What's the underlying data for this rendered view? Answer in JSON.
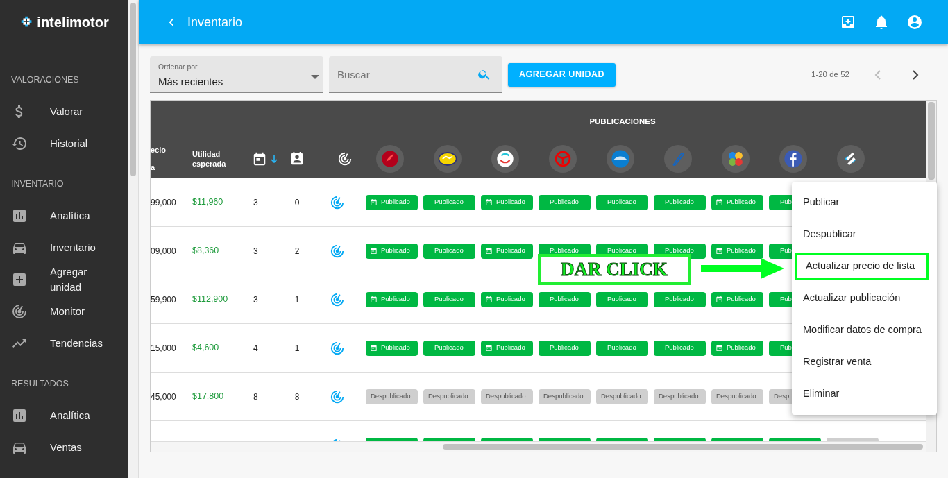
{
  "sidebar": {
    "logo": "intelimotor",
    "sections": [
      {
        "title": "VALORACIONES",
        "items": [
          {
            "label": "Valorar"
          },
          {
            "label": "Historial"
          }
        ]
      },
      {
        "title": "INVENTARIO",
        "items": [
          {
            "label": "Analítica"
          },
          {
            "label": "Inventario"
          },
          {
            "label": "Agregar unidad"
          },
          {
            "label": "Monitor"
          },
          {
            "label": "Tendencias"
          }
        ]
      },
      {
        "title": "RESULTADOS",
        "items": [
          {
            "label": "Analítica"
          },
          {
            "label": "Ventas"
          }
        ]
      }
    ]
  },
  "app_bar": {
    "title": "Inventario"
  },
  "toolbar": {
    "sort": {
      "label": "Ordenar por",
      "value": "Más recientes"
    },
    "search": {
      "placeholder": "Buscar"
    },
    "add_button": "AGREGAR UNIDAD",
    "pagination": "1-20 de 52",
    "prev": {
      "disabled": true
    },
    "next": {
      "disabled": false
    }
  },
  "table": {
    "group_header": "PUBLICACIONES",
    "columns": [
      {
        "lines": [
          "ecio",
          "a"
        ]
      },
      {
        "lines": [
          "Utilidad",
          "esperada"
        ]
      }
    ],
    "days_sorted": true,
    "rows": [
      {
        "price": "99,000",
        "profit": "$11,960",
        "days": "3",
        "leads": "0",
        "pubs": [
          {
            "published": true,
            "icon": true,
            "label": "Publicado"
          },
          {
            "published": true,
            "icon": false,
            "label": "Publicado"
          },
          {
            "published": true,
            "icon": true,
            "label": "Publicado"
          },
          {
            "published": true,
            "icon": false,
            "label": "Publicado"
          },
          {
            "published": true,
            "icon": false,
            "label": "Publicado"
          },
          {
            "published": true,
            "icon": false,
            "label": "Publicado"
          },
          {
            "published": true,
            "icon": true,
            "label": "Publicado"
          },
          {
            "published": true,
            "icon": false,
            "label": "Pub"
          }
        ]
      },
      {
        "price": "09,000",
        "profit": "$8,360",
        "days": "3",
        "leads": "2",
        "pubs": [
          {
            "published": true,
            "icon": true,
            "label": "Publicado"
          },
          {
            "published": true,
            "icon": false,
            "label": "Publicado"
          },
          {
            "published": true,
            "icon": true,
            "label": "Publicado"
          },
          {
            "published": true,
            "icon": false,
            "label": "Publicado"
          },
          {
            "published": true,
            "icon": false,
            "label": "Publicado"
          },
          {
            "published": true,
            "icon": false,
            "label": "Publicado"
          },
          {
            "published": true,
            "icon": true,
            "label": "Publicado"
          },
          {
            "published": true,
            "icon": false,
            "label": "Pub"
          }
        ]
      },
      {
        "price": "59,900",
        "profit": "$112,900",
        "days": "3",
        "leads": "1",
        "pubs": [
          {
            "published": true,
            "icon": true,
            "label": "Publicado"
          },
          {
            "published": true,
            "icon": false,
            "label": "Publicado"
          },
          {
            "published": true,
            "icon": true,
            "label": "Publicado"
          },
          {
            "published": true,
            "icon": false,
            "label": "Publicado"
          },
          {
            "published": true,
            "icon": false,
            "label": "Publicado"
          },
          {
            "published": true,
            "icon": false,
            "label": "Publicado"
          },
          {
            "published": true,
            "icon": true,
            "label": "Publicado"
          },
          {
            "published": true,
            "icon": false,
            "label": "Pub"
          }
        ]
      },
      {
        "price": "15,000",
        "profit": "$4,600",
        "days": "4",
        "leads": "1",
        "pubs": [
          {
            "published": true,
            "icon": true,
            "label": "Publicado"
          },
          {
            "published": true,
            "icon": false,
            "label": "Publicado"
          },
          {
            "published": true,
            "icon": true,
            "label": "Publicado"
          },
          {
            "published": true,
            "icon": false,
            "label": "Publicado"
          },
          {
            "published": true,
            "icon": false,
            "label": "Publicado"
          },
          {
            "published": true,
            "icon": false,
            "label": "Publicado"
          },
          {
            "published": true,
            "icon": true,
            "label": "Publicado"
          },
          {
            "published": true,
            "icon": false,
            "label": "Pub"
          }
        ]
      },
      {
        "price": "45,000",
        "profit": "$17,800",
        "days": "8",
        "leads": "8",
        "pubs": [
          {
            "published": false,
            "icon": false,
            "label": "Despublicado"
          },
          {
            "published": false,
            "icon": false,
            "label": "Despublicado"
          },
          {
            "published": false,
            "icon": false,
            "label": "Despublicado"
          },
          {
            "published": false,
            "icon": false,
            "label": "Despublicado"
          },
          {
            "published": false,
            "icon": false,
            "label": "Despublicado"
          },
          {
            "published": false,
            "icon": false,
            "label": "Despublicado"
          },
          {
            "published": false,
            "icon": false,
            "label": "Despublicado"
          },
          {
            "published": false,
            "icon": false,
            "label": "Desp"
          }
        ]
      },
      {
        "pubs": [
          {
            "published": true
          },
          {
            "published": true
          },
          {
            "published": true
          },
          {
            "published": true
          },
          {
            "published": true
          },
          {
            "published": true
          },
          {
            "published": true
          },
          {
            "published": true
          },
          {
            "published": false
          }
        ]
      }
    ]
  },
  "menu": {
    "items": [
      {
        "label": "Publicar",
        "highlighted": false
      },
      {
        "label": "Despublicar",
        "highlighted": false
      },
      {
        "label": "Actualizar precio de lista",
        "highlighted": true
      },
      {
        "label": "Actualizar publicación",
        "highlighted": false
      },
      {
        "label": "Modificar datos de compra",
        "highlighted": false
      },
      {
        "label": "Registrar venta",
        "highlighted": false
      },
      {
        "label": "Eliminar",
        "highlighted": false
      }
    ]
  },
  "annotation": {
    "text": "DAR CLICK"
  }
}
